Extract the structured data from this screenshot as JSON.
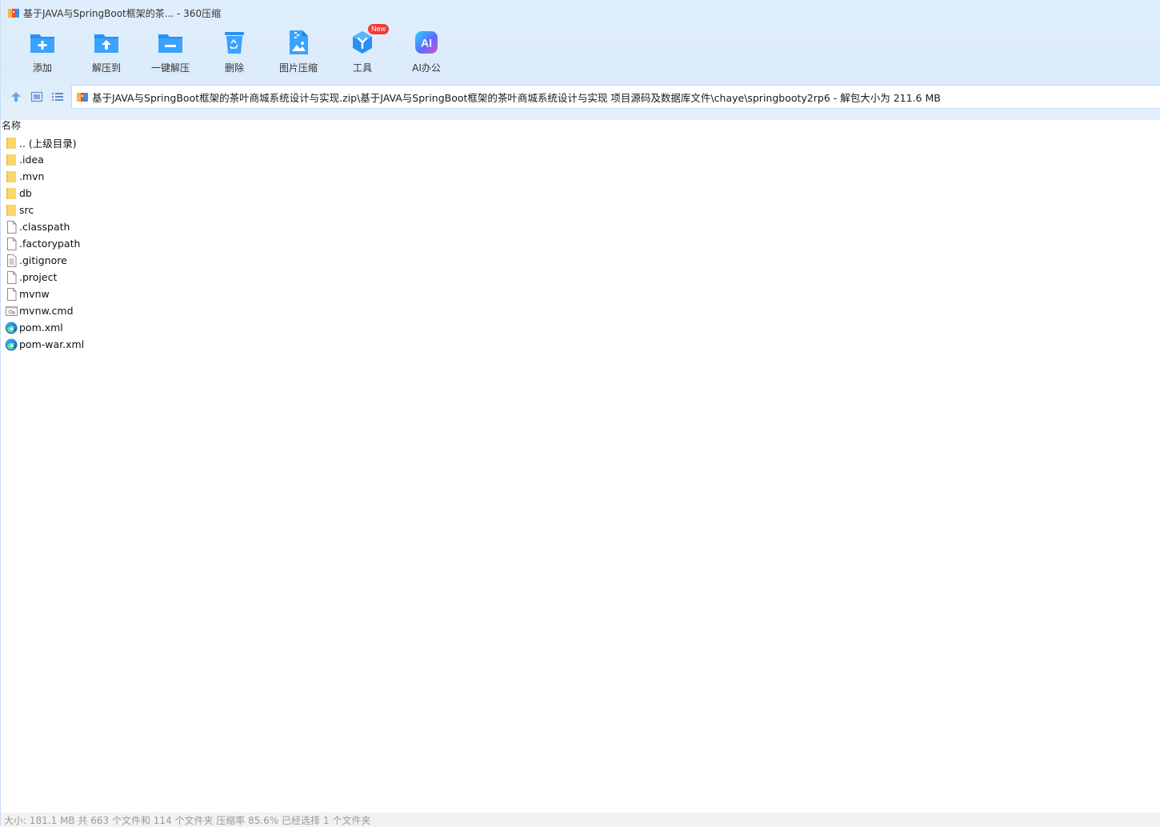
{
  "window": {
    "title": "基于JAVA与SpringBoot框架的茶... - 360压缩",
    "app_icon": "archive-icon"
  },
  "toolbar": {
    "items": [
      {
        "label": "添加",
        "icon": "add-folder-icon"
      },
      {
        "label": "解压到",
        "icon": "extract-to-icon"
      },
      {
        "label": "一键解压",
        "icon": "one-click-extract-icon"
      },
      {
        "label": "删除",
        "icon": "recycle-bin-icon"
      },
      {
        "label": "图片压缩",
        "icon": "image-compress-icon"
      },
      {
        "label": "工具",
        "icon": "tools-icon",
        "badge": "New"
      },
      {
        "label": "AI办公",
        "icon": "ai-office-icon",
        "icon_text": "AI"
      }
    ]
  },
  "nav": {
    "path": "基于JAVA与SpringBoot框架的茶叶商城系统设计与实现.zip\\基于JAVA与SpringBoot框架的茶叶商城系统设计与实现 项目源码及数据库文件\\chaye\\springbooty2rp6 - 解包大小为 211.6 MB"
  },
  "list": {
    "header_name": "名称",
    "files": [
      {
        "name": ".. (上级目录)",
        "type": "folder"
      },
      {
        "name": ".idea",
        "type": "folder"
      },
      {
        "name": ".mvn",
        "type": "folder"
      },
      {
        "name": "db",
        "type": "folder"
      },
      {
        "name": "src",
        "type": "folder"
      },
      {
        "name": ".classpath",
        "type": "file"
      },
      {
        "name": ".factorypath",
        "type": "file"
      },
      {
        "name": ".gitignore",
        "type": "text"
      },
      {
        "name": ".project",
        "type": "file"
      },
      {
        "name": "mvnw",
        "type": "file"
      },
      {
        "name": "mvnw.cmd",
        "type": "cmd"
      },
      {
        "name": "pom.xml",
        "type": "edge"
      },
      {
        "name": "pom-war.xml",
        "type": "edge"
      }
    ]
  },
  "status": {
    "text": "大小: 181.1 MB 共 663 个文件和 114 个文件夹 压缩率 85.6% 已经选择 1 个文件夹"
  },
  "colors": {
    "accent": "#1e8ff0",
    "folder": "#f9d76b",
    "badge": "#f03a3a"
  }
}
